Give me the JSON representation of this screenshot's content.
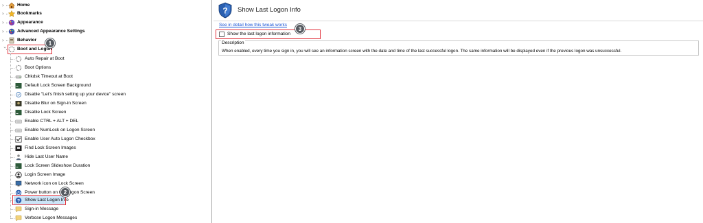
{
  "tree": {
    "top_items": [
      {
        "label": "Home",
        "icon": "home-icon",
        "expanded": false
      },
      {
        "label": "Bookmarks",
        "icon": "star-icon",
        "expanded": false
      },
      {
        "label": "Appearance",
        "icon": "appearance-icon",
        "expanded": false
      },
      {
        "label": "Advanced Appearance Settings",
        "icon": "advanced-appearance-icon",
        "expanded": false
      },
      {
        "label": "Behavior",
        "icon": "behavior-icon",
        "expanded": false
      },
      {
        "label": "Boot and Logon",
        "icon": "boot-logon-icon",
        "expanded": true
      }
    ],
    "children": [
      {
        "label": "Auto Repair at Boot",
        "icon": "spinner-icon"
      },
      {
        "label": "Boot Options",
        "icon": "spinner-icon"
      },
      {
        "label": "Chkdsk Timeout at Boot",
        "icon": "drive-icon"
      },
      {
        "label": "Default Lock Screen Background",
        "icon": "lock-screen-icon"
      },
      {
        "label": "Disable \"Let's finish setting up your device\" screen",
        "icon": "setup-icon"
      },
      {
        "label": "Disable Blur on Sign-in Screen",
        "icon": "blur-icon"
      },
      {
        "label": "Disable Lock Screen",
        "icon": "lock-screen-icon"
      },
      {
        "label": "Enable CTRL + ALT + DEL",
        "icon": "keyboard-icon"
      },
      {
        "label": "Enable NumLock on Logon Screen",
        "icon": "keyboard-icon"
      },
      {
        "label": "Enable User Auto Logon Checkbox",
        "icon": "checkbox-icon"
      },
      {
        "label": "Find Lock Screen Images",
        "icon": "image-folder-icon"
      },
      {
        "label": "Hide Last User Name",
        "icon": "user-icon"
      },
      {
        "label": "Lock Screen Slideshow Duration",
        "icon": "lock-screen-icon"
      },
      {
        "label": "Login Screen Image",
        "icon": "user-circle-icon"
      },
      {
        "label": "Network icon on Lock Screen",
        "icon": "network-icon"
      },
      {
        "label": "Power button on the Logon Screen",
        "icon": "power-icon"
      },
      {
        "label": "Show Last Logon Info",
        "icon": "shield-question-icon"
      },
      {
        "label": "Sign-in Message",
        "icon": "message-icon"
      },
      {
        "label": "Verbose Logon Messages",
        "icon": "message-icon"
      }
    ],
    "selected_index": 16
  },
  "callouts": [
    "1",
    "2",
    "3"
  ],
  "detail": {
    "title": "Show Last Logon Info",
    "link_text": "See in detail how this tweak works",
    "checkbox_label": "Show the last logon information",
    "checkbox_checked": false,
    "description_legend": "Description",
    "description_text": "When enabled, every time you sign in, you will see an information screen with the date and time of the last successful logon. The same information will be displayed even if the previous logon was unsuccessful."
  },
  "colors": {
    "highlight_red": "#e0303a",
    "selection_blue": "#cce4f7",
    "link_blue": "#1a55d6",
    "callout_gray": "#555a60"
  }
}
